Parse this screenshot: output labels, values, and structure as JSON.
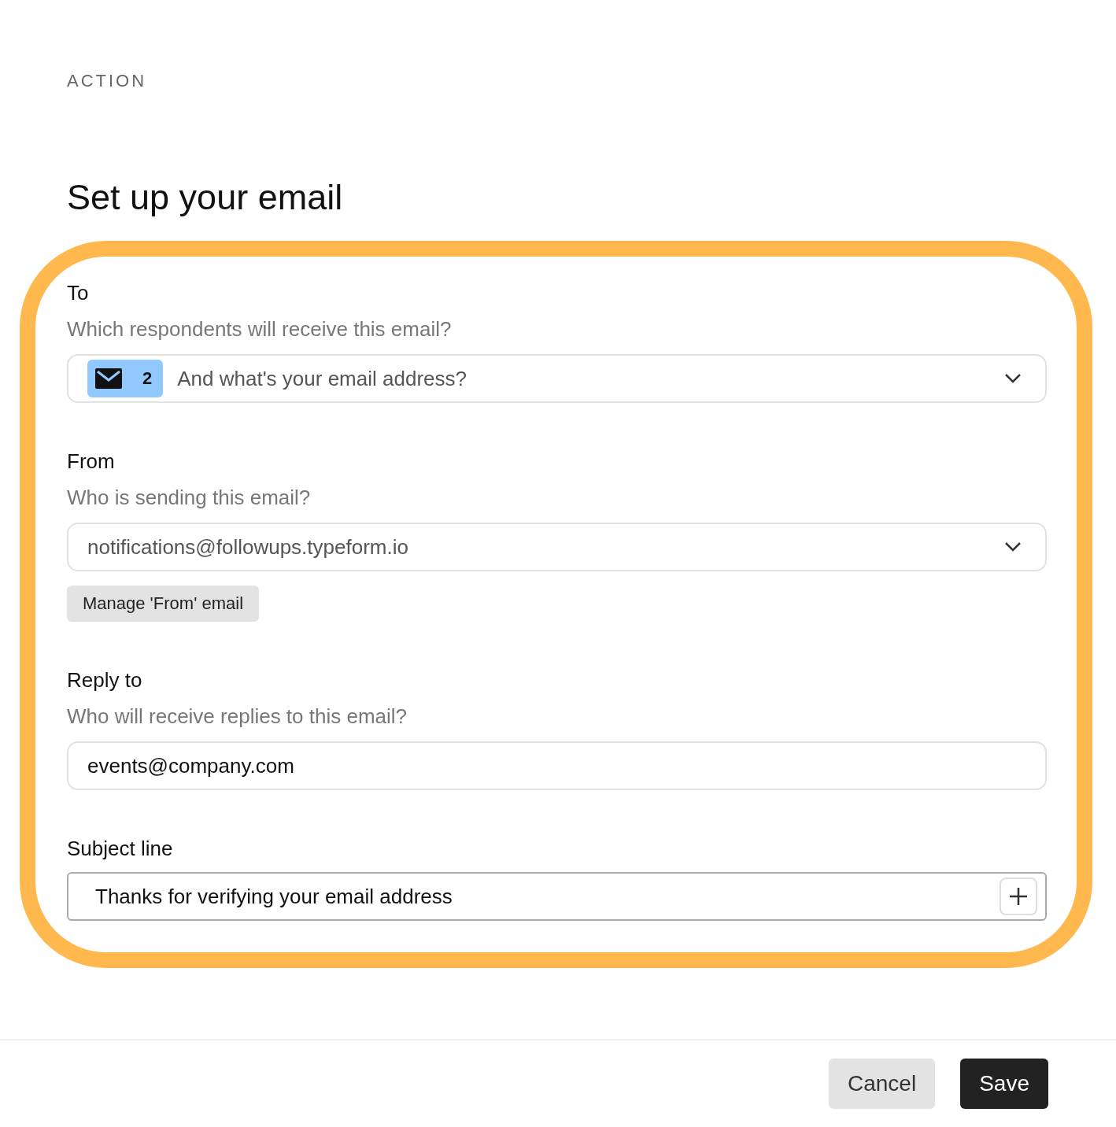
{
  "header": {
    "eyebrow": "ACTION",
    "title": "Set up your email"
  },
  "sections": [
    {
      "kind": "select",
      "label": "To",
      "hint": "Which respondents will receive this email?",
      "badge": "2",
      "value": "And what's your email address?"
    },
    {
      "kind": "select",
      "label": "From",
      "hint": "Who is sending this email?",
      "value": "notifications@followups.typeform.io",
      "action": "Manage 'From' email"
    },
    {
      "kind": "input",
      "label": "Reply to",
      "hint": "Who will receive replies to this email?",
      "value": "events@company.com"
    },
    {
      "kind": "subject",
      "label": "Subject line",
      "value": "Thanks for verifying your email address"
    }
  ],
  "footer": {
    "buttons": [
      {
        "label": "Cancel",
        "kind": "secondary"
      },
      {
        "label": "Save",
        "kind": "primary"
      }
    ]
  }
}
